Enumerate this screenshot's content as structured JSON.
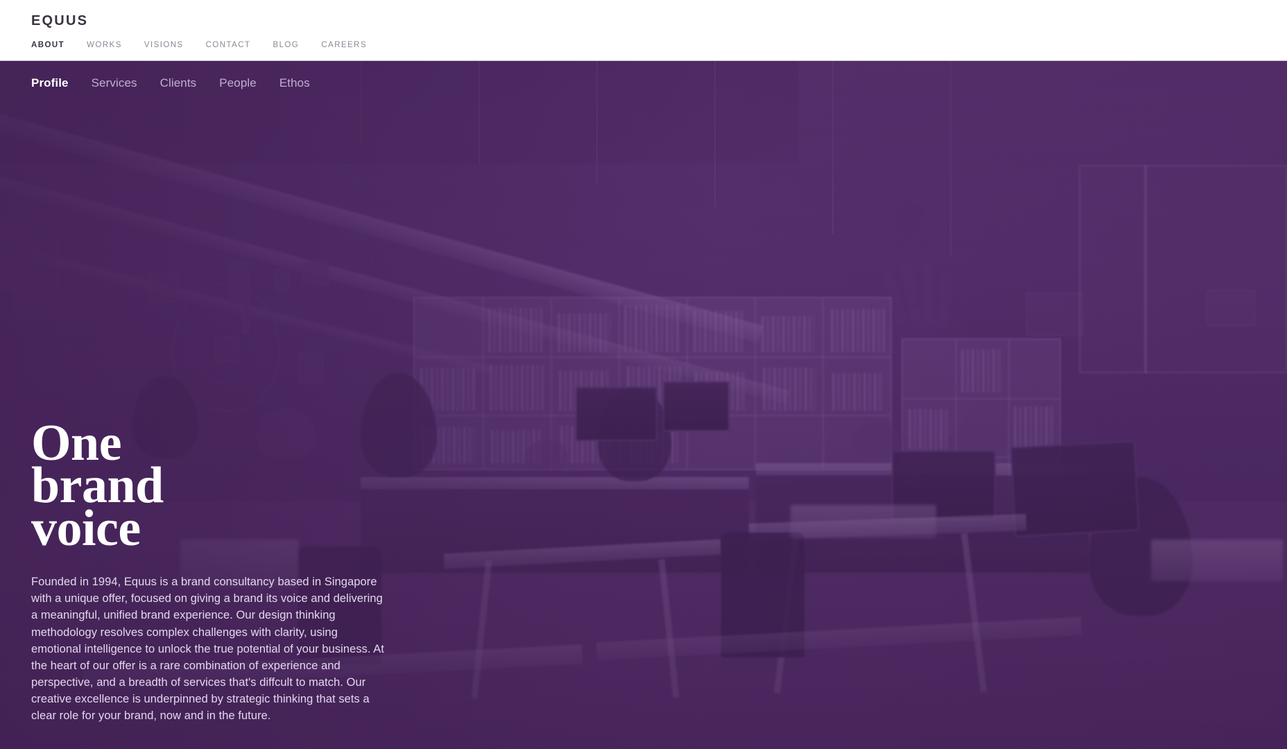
{
  "header": {
    "logo": "EQUUS",
    "primary_nav": [
      {
        "label": "ABOUT",
        "active": true
      },
      {
        "label": "WORKS",
        "active": false
      },
      {
        "label": "VISIONS",
        "active": false
      },
      {
        "label": "CONTACT",
        "active": false
      },
      {
        "label": "BLOG",
        "active": false
      },
      {
        "label": "CAREERS",
        "active": false
      }
    ]
  },
  "secondary_nav": [
    {
      "label": "Profile",
      "active": true
    },
    {
      "label": "Services",
      "active": false
    },
    {
      "label": "Clients",
      "active": false
    },
    {
      "label": "People",
      "active": false
    },
    {
      "label": "Ethos",
      "active": false
    }
  ],
  "hero": {
    "headline_lines": [
      "One",
      "brand",
      "voice"
    ],
    "paragraph": "Founded in 1994, Equus is a brand consultancy based in Singapore with a unique offer, focused on giving a brand its voice and delivering a meaningful, unified brand experience. Our design thinking methodology resolves complex challenges with clarity, using emotional intelligence to unlock the true potential of your business. At the heart of our offer is a rare combination of experience and perspective, and a breadth of services that's diffcult to match. Our creative excellence is underpinned by strategic thinking that sets a clear role for your brand, now and in the future.",
    "background_description": "office interior photograph with purple duotone overlay"
  },
  "colors": {
    "header_background": "#ffffff",
    "header_text_active": "#3a3340",
    "header_text_inactive": "#8d8794",
    "hero_purple": "#5a3270",
    "hero_purple_dark": "#4b2a5e",
    "subnav_active": "#ffffff",
    "subnav_inactive": "#c2aed0",
    "headline_text": "#ffffff",
    "paragraph_text": "#e3d7ec",
    "header_border": "#cdbfd4"
  }
}
